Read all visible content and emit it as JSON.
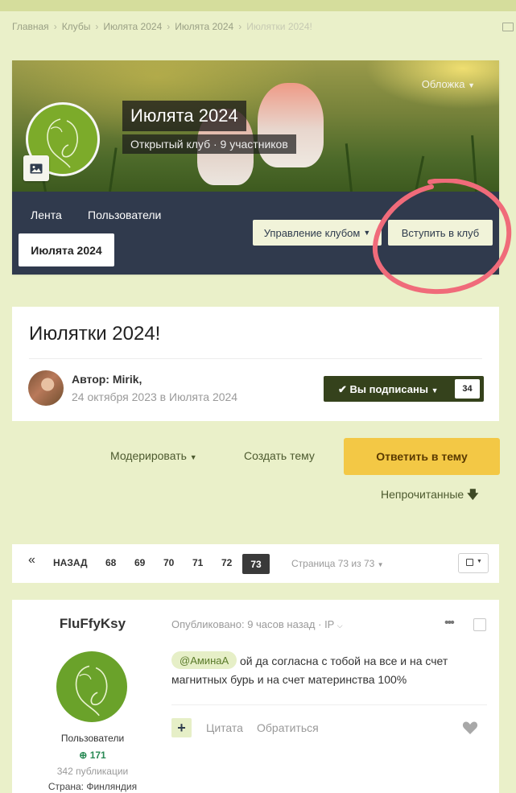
{
  "breadcrumb": {
    "items": [
      "Главная",
      "Клубы",
      "Июлята 2024",
      "Июлята 2024"
    ],
    "current": "Июлятки 2024!"
  },
  "club": {
    "cover_button": "Обложка",
    "title": "Июлята 2024",
    "type": "Открытый клуб",
    "members": "9 участников",
    "tabs": [
      "Лента",
      "Пользователи"
    ],
    "active_tab": "Июлята 2024",
    "manage_button": "Управление клубом",
    "join_button": "Вступить в клуб"
  },
  "topic": {
    "title": "Июлятки 2024!",
    "author_label": "Автор: Mirik,",
    "date": "24 октября 2023 в Июлята 2024",
    "follow_label": "Вы подписаны",
    "follow_count": "34"
  },
  "actions": {
    "moderate": "Модерировать",
    "create": "Создать тему",
    "reply": "Ответить в тему",
    "unread": "Непрочитанные"
  },
  "pagination": {
    "prev_symbol": "«",
    "prev_label": "НАЗАД",
    "pages": [
      "68",
      "69",
      "70",
      "71",
      "72"
    ],
    "current": "73",
    "info": "Страница 73 из 73"
  },
  "post": {
    "author": "FluFfyKsy",
    "group": "Пользователи",
    "reputation": "171",
    "posts_count": "342 публикации",
    "country": "Страна: Финляндия",
    "published": "Опубликовано: 9 часов назад",
    "ip_label": "IP",
    "mention": "@АминаА",
    "text_line1": "ой да согласна с тобой на все и на счет",
    "text_line2": "магнитных бурь и на счет материнства 100%",
    "plus_label": "+",
    "quote": "Цитата",
    "contact": "Обратиться"
  },
  "icons": {
    "image": "image-icon",
    "checkmark": "check-icon",
    "arrow_down": "arrow-down-icon",
    "dots": "more-dots-icon",
    "heart": "heart-icon",
    "rss": "rss-icon"
  },
  "colors": {
    "page_bg": "#eaf0c9",
    "club_nav_bg": "#303a4d",
    "follow_bg": "#35421c",
    "reply_bg": "#f3c845",
    "annotation": "#f06b7a"
  }
}
